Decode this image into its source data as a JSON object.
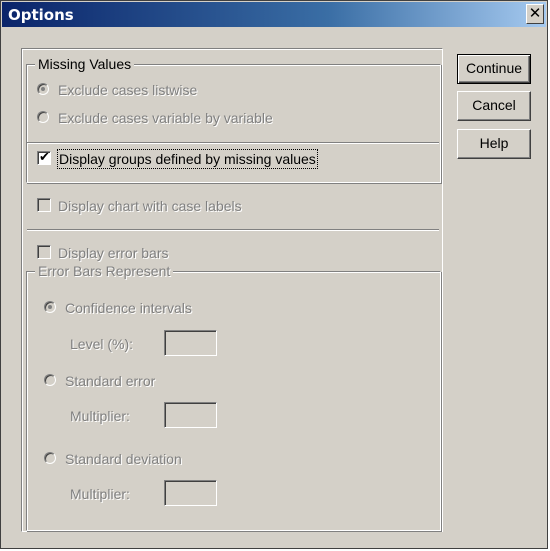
{
  "window": {
    "title": "Options",
    "close_glyph": "✕"
  },
  "missing_values": {
    "legend": "Missing Values",
    "option_listwise": "Exclude cases listwise",
    "option_variable": "Exclude cases variable by variable",
    "selected": "Exclude cases listwise"
  },
  "display_groups": {
    "label": "Display groups defined by missing values",
    "checked": true
  },
  "chart_case_labels": {
    "label": "Display chart with case labels",
    "checked": false
  },
  "error_bars": {
    "label": "Display error bars",
    "checked": false
  },
  "error_bars_represent": {
    "legend": "Error Bars Represent",
    "confidence": "Confidence intervals",
    "level_label": "Level (%):",
    "level_value": "",
    "standard_error": "Standard error",
    "se_multiplier_label": "Multiplier:",
    "se_multiplier_value": "",
    "standard_deviation": "Standard deviation",
    "sd_multiplier_label": "Multiplier:",
    "sd_multiplier_value": "",
    "selected": "Confidence intervals"
  },
  "buttons": {
    "continue": "Continue",
    "cancel": "Cancel",
    "help": "Help"
  },
  "colors": {
    "face": "#d4d0c8",
    "title_start": "#0a246a",
    "title_end": "#a6caf0",
    "disabled_text": "#808080"
  }
}
